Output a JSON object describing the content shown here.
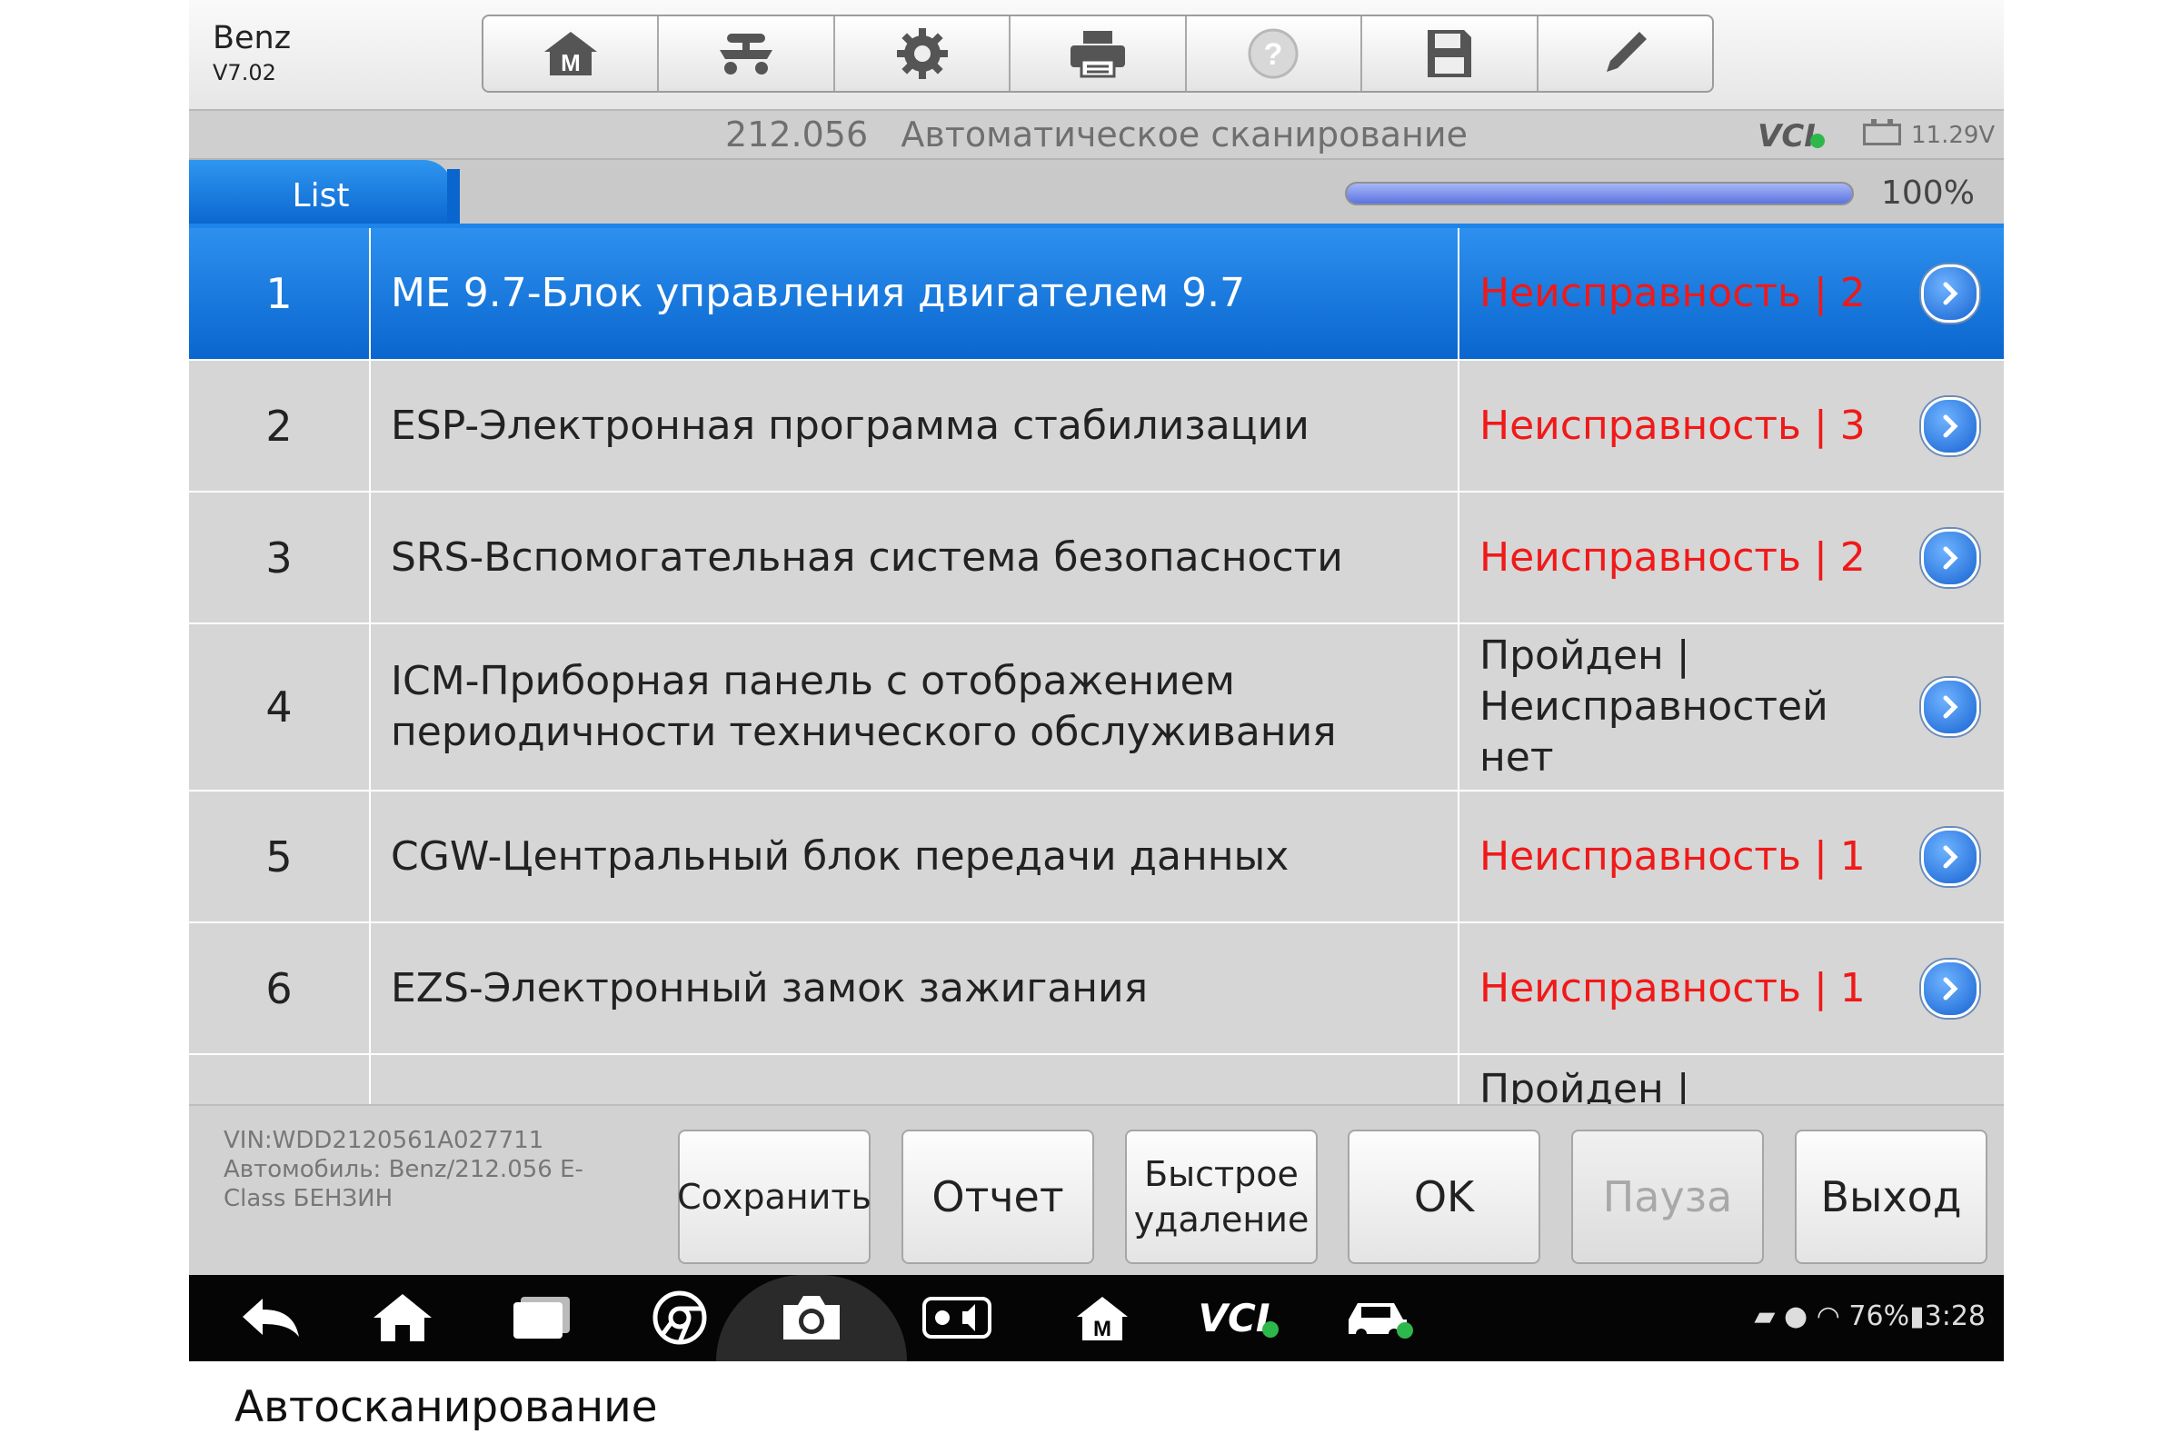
{
  "brand": {
    "name": "Benz",
    "version": "V7.02"
  },
  "toolbar": {
    "buttons": [
      {
        "icon": "home-m-icon"
      },
      {
        "icon": "vehicle-lift-icon"
      },
      {
        "icon": "gear-icon"
      },
      {
        "icon": "printer-icon"
      },
      {
        "icon": "help-icon"
      },
      {
        "icon": "save-disk-icon"
      },
      {
        "icon": "pen-icon"
      }
    ]
  },
  "titlebar": {
    "title": "212.056   Автоматическое сканирование",
    "vci_label": "VCI",
    "voltage": "11.29V"
  },
  "tab": {
    "label": "List"
  },
  "progress": {
    "value": 1.0,
    "text": "100%"
  },
  "rows": [
    {
      "num": "1",
      "name": "ME 9.7-Блок управления двигателем 9.7",
      "status": "Неисправность | 2",
      "fault": true,
      "selected": true
    },
    {
      "num": "2",
      "name": "ESP-Электронная программа стабилизации",
      "status": "Неисправность | 3",
      "fault": true
    },
    {
      "num": "3",
      "name": "SRS-Вспомогательная система безопасности",
      "status": "Неисправность | 2",
      "fault": true
    },
    {
      "num": "4",
      "name": "ICM-Приборная панель с отображением периодичности технического обслуживания",
      "status": "Пройден | Неисправностей нет",
      "fault": false
    },
    {
      "num": "5",
      "name": "CGW-Центральный блок передачи данных",
      "status": "Неисправность | 1",
      "fault": true
    },
    {
      "num": "6",
      "name": "EZS-Электронный замок зажигания",
      "status": "Неисправность | 1",
      "fault": true
    },
    {
      "num": "",
      "name": "",
      "status": "Пройден |",
      "fault": false
    }
  ],
  "footer": {
    "vin": "VIN:WDD2120561A027711",
    "vehicle": "Автомобиль: Benz/212.056 E-Class БЕНЗИН",
    "buttons": {
      "save": "Сохранить",
      "report": "Отчет",
      "quick_clear": "Быстрое удаление",
      "ok": "OK",
      "pause": "Пауза",
      "exit": "Выход"
    }
  },
  "system_bar": {
    "icons": [
      "back-icon",
      "home-icon",
      "recent-apps-icon",
      "chrome-icon",
      "camera-icon",
      "brightness-volume-icon",
      "maxisys-home-icon",
      "vci-icon",
      "car-icon"
    ],
    "vci_label": "VCI",
    "status_text": "76%",
    "time": "3:28"
  },
  "caption": "Автосканирование",
  "colors": {
    "accent": "#1d84ea",
    "fault": "#f01919",
    "row_bg": "#d6d6d6"
  }
}
